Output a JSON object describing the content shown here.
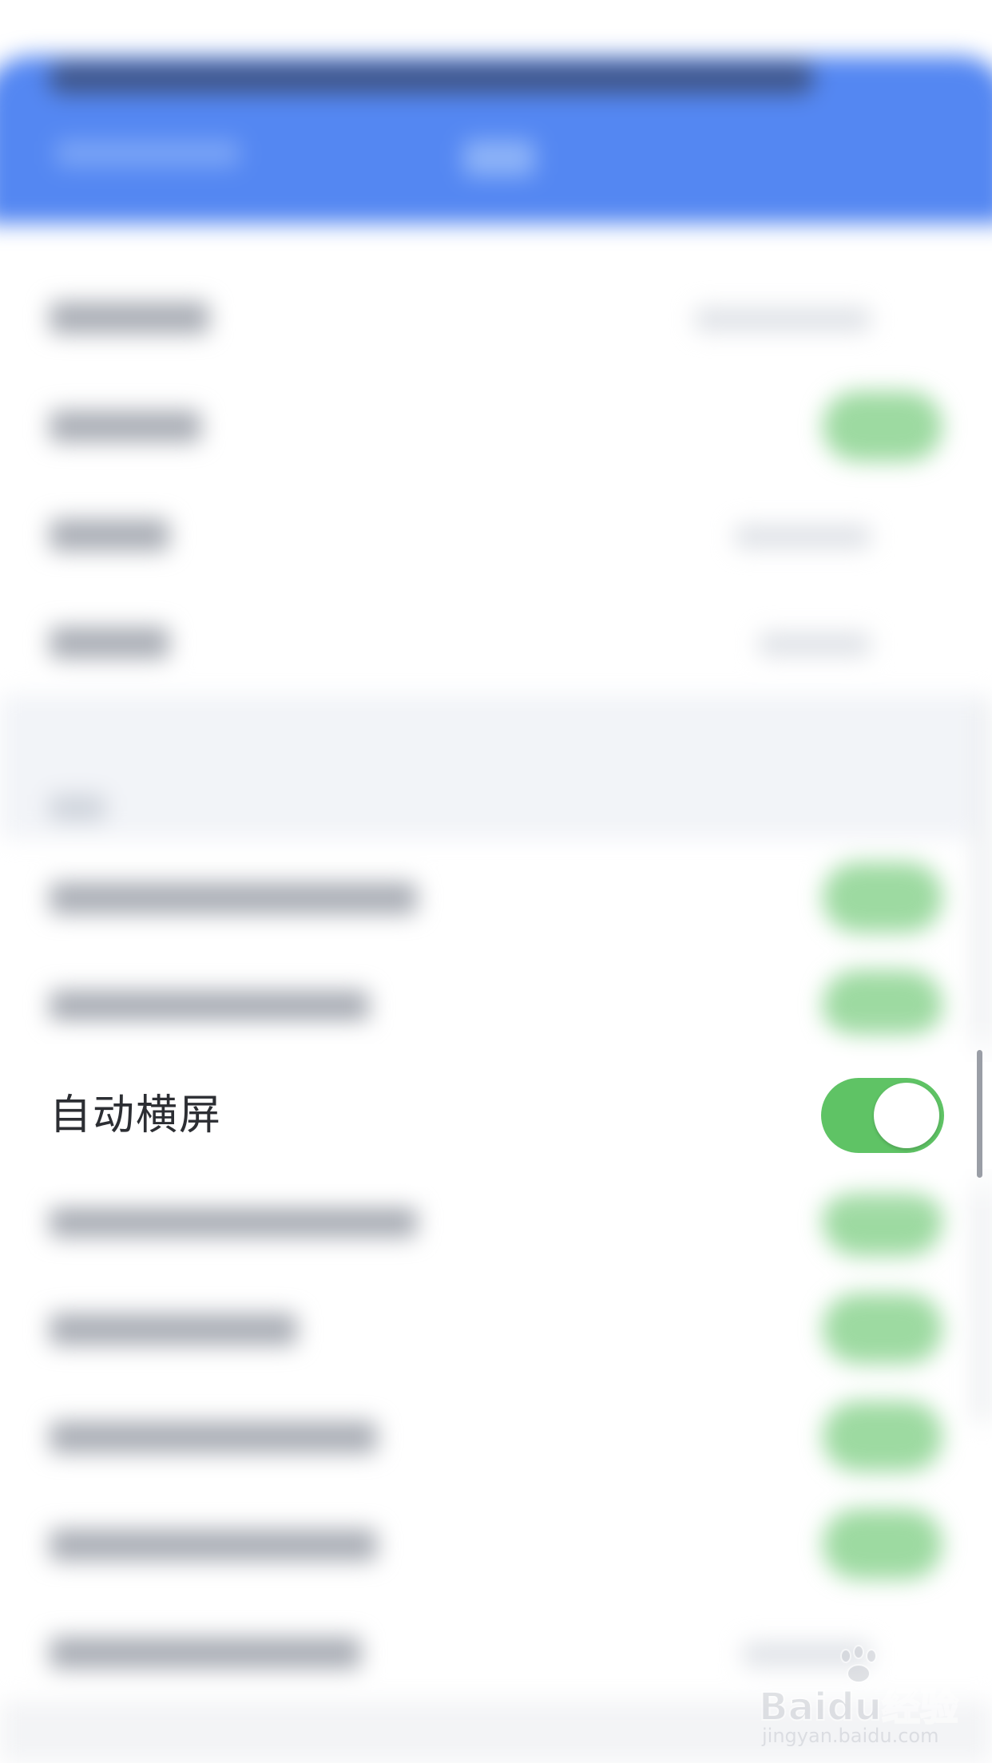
{
  "setting": {
    "label": "自动横屏",
    "enabled": true,
    "on_color": "#5fc365"
  },
  "theme": {
    "header_color": "#5487f2"
  },
  "watermark": {
    "brand": "Baidu经验",
    "url": "jingyan.baidu.com"
  }
}
